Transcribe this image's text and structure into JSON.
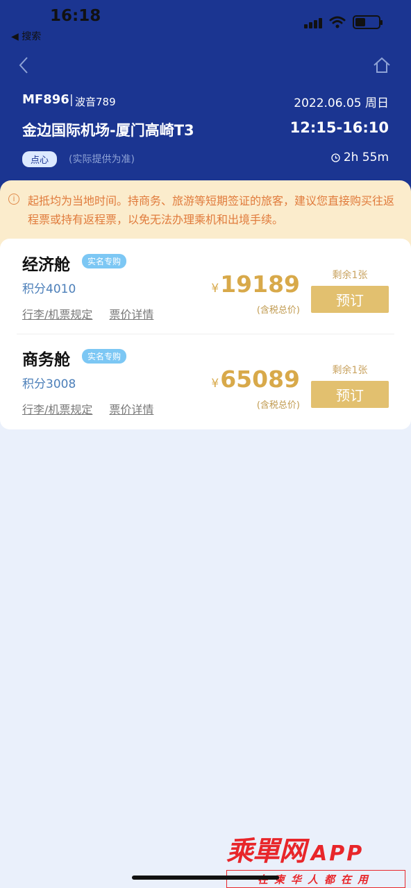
{
  "status_bar": {
    "time": "16:18",
    "back_label": "◀ 搜索"
  },
  "flight": {
    "number": "MF896",
    "separator": "|",
    "aircraft": "波音789",
    "date": "2022.06.05 周日",
    "route": "金边国际机场-厦门高崎T3",
    "times": "12:15-16:10",
    "meal_badge": "点心",
    "meal_note": "(实际提供为准)",
    "duration": "2h 55m"
  },
  "notice": {
    "icon": "info-icon",
    "text": "起抵均为当地时间。持商务、旅游等短期签证的旅客，建议您直接购买往返程票或持有返程票，以免无法办理乘机和出境手续。"
  },
  "cabins": [
    {
      "name": "经济舱",
      "tag": "实名专购",
      "points": "积分4010",
      "link_rules": "行李/机票规定",
      "link_price": "票价详情",
      "currency": "¥",
      "price": "19189",
      "price_note": "(含税总价)",
      "remain": "剩余1张",
      "book_label": "预订"
    },
    {
      "name": "商务舱",
      "tag": "实名专购",
      "points": "积分3008",
      "link_rules": "行李/机票规定",
      "link_price": "票价详情",
      "currency": "¥",
      "price": "65089",
      "price_note": "(含税总价)",
      "remain": "剩余1张",
      "book_label": "预订"
    }
  ],
  "watermark": {
    "brand": "乘單网",
    "app": "APP",
    "slogan": "在柬华人都在用"
  },
  "colors": {
    "header": "#1b3591",
    "notice_bg": "#fbeccc",
    "price": "#d8a94a",
    "book_button": "#e2c06f",
    "tag": "#7cc7f4"
  }
}
